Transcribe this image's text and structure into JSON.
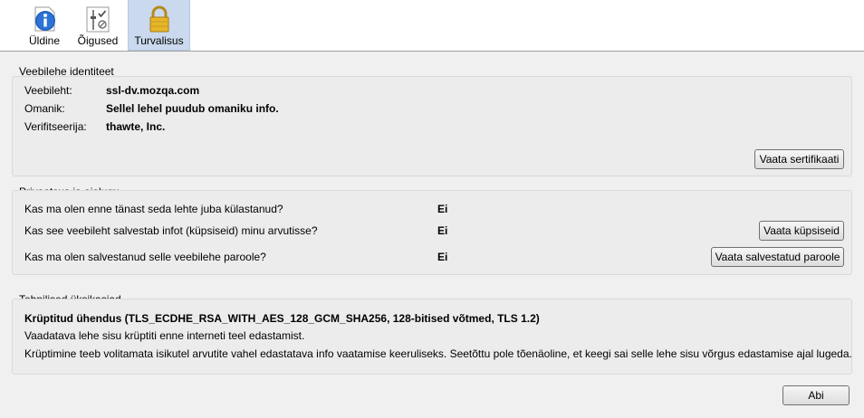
{
  "tabs": [
    {
      "label": "Üldine",
      "icon": "info-icon"
    },
    {
      "label": "Õigused",
      "icon": "permissions-icon"
    },
    {
      "label": "Turvalisus",
      "icon": "lock-icon"
    }
  ],
  "identity": {
    "title": "Veebilehe identiteet",
    "website_label": "Veebileht:",
    "website_value": "ssl-dv.mozqa.com",
    "owner_label": "Omanik:",
    "owner_value": "Sellel lehel puudub omaniku info.",
    "verifier_label": "Verifitseerija:",
    "verifier_value": "thawte, Inc.",
    "view_cert_button": "Vaata sertifikaati"
  },
  "privacy": {
    "title": "Privaatsus ja ajalugu",
    "q1": "Kas ma olen enne tänast seda lehte juba külastanud?",
    "a1": "Ei",
    "q2": "Kas see veebileht salvestab infot (küpsiseid) minu arvutisse?",
    "a2": "Ei",
    "q3": "Kas ma olen salvestanud selle veebilehe paroole?",
    "a3": "Ei",
    "cookies_button": "Vaata küpsiseid",
    "passwords_button": "Vaata salvestatud paroole"
  },
  "technical": {
    "title": "Tehnilised üksikasjad",
    "line1": "Krüptitud ühendus (TLS_ECDHE_RSA_WITH_AES_128_GCM_SHA256, 128-bitised võtmed, TLS 1.2)",
    "line2": "Vaadatava lehe sisu krüptiti enne interneti teel edastamist.",
    "line3": "Krüptimine teeb volitamata isikutel arvutite vahel edastatava info vaatamise keeruliseks. Seetõttu pole tõenäoline, et keegi sai selle lehe sisu võrgus edastamise ajal lugeda."
  },
  "footer": {
    "help_button": "Abi"
  }
}
